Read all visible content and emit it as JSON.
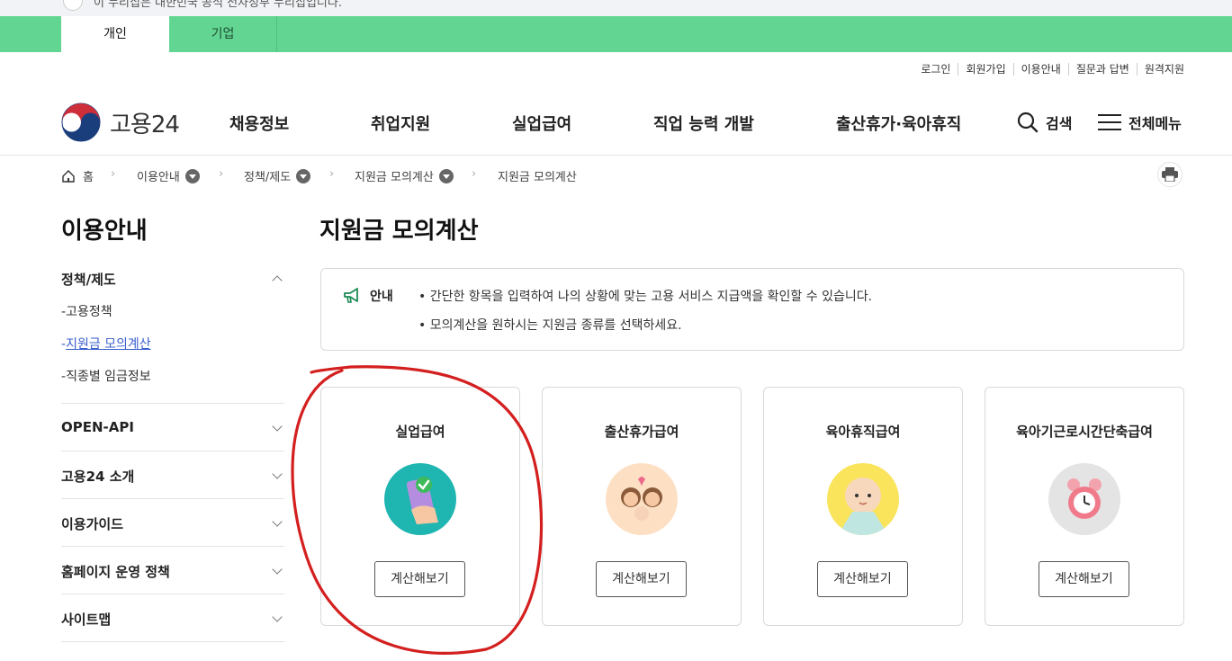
{
  "gov_banner": "이 누리집은 대한민국 공식 전자정부 누리집입니다.",
  "top_tabs": [
    {
      "label": "개인"
    },
    {
      "label": "기업"
    }
  ],
  "util_links": [
    "로그인",
    "회원가입",
    "이용안내",
    "질문과 답변",
    "원격지원"
  ],
  "logo": {
    "name": "고용24"
  },
  "gnb": [
    "채용정보",
    "취업지원",
    "실업급여",
    "직업 능력 개발",
    "출산휴가·육아휴직"
  ],
  "search_label": "검색",
  "menu_label": "전체메뉴",
  "breadcrumb": [
    "홈",
    "이용안내",
    "정책/제도",
    "지원금 모의계산",
    "지원금 모의계산"
  ],
  "sidebar": {
    "title": "이용안내",
    "groups": [
      {
        "label": "정책/제도",
        "sub": [
          {
            "label": "고용정책"
          },
          {
            "label": "지원금 모의계산"
          },
          {
            "label": "직종별 임금정보"
          }
        ]
      },
      {
        "label": "OPEN-API"
      },
      {
        "label": "고용24 소개"
      },
      {
        "label": "이용가이드"
      },
      {
        "label": "홈페이지 운영 정책"
      },
      {
        "label": "사이트맵"
      }
    ]
  },
  "page_title": "지원금 모의계산",
  "notice": {
    "label": "안내",
    "lines": [
      "간단한 항목을 입력하여 나의 상황에 맞는 고용 서비스 지급액을 확인할 수 있습니다.",
      "모의계산을 원하시는 지원금 종류를 선택하세요."
    ]
  },
  "cards": [
    {
      "title": "실업급여",
      "button": "계산해보기",
      "icon": "phone-check-icon",
      "bg": "#1fb5b0"
    },
    {
      "title": "출산휴가급여",
      "button": "계산해보기",
      "icon": "parents-baby-icon",
      "bg": "#fde0c4"
    },
    {
      "title": "육아휴직급여",
      "button": "계산해보기",
      "icon": "baby-face-icon",
      "bg": "#f9e45c"
    },
    {
      "title": "육아기근로시간단축급여",
      "button": "계산해보기",
      "icon": "alarm-clock-icon",
      "bg": "#e4e4e4"
    }
  ],
  "colors": {
    "tab_bar": "#62d592",
    "link_current": "#3a5fcd",
    "annotation": "#d41f1f"
  }
}
